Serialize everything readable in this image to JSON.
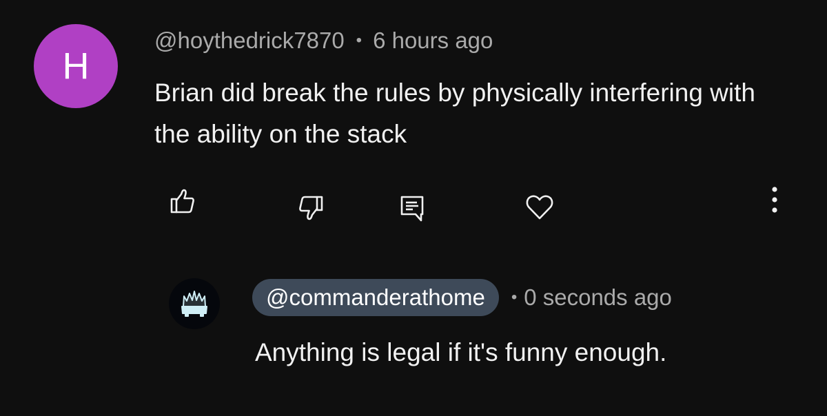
{
  "comment": {
    "avatar_letter": "H",
    "avatar_color": "#b040c4",
    "handle": "@hoythedrick7870",
    "separator": "•",
    "timestamp": "6 hours ago",
    "text": "Brian did break the rules by physically interfering with the ability on the stack",
    "actions": {
      "like_icon": "thumbs-up-icon",
      "dislike_icon": "thumbs-down-icon",
      "reply_icon": "reply-icon",
      "heart_icon": "heart-icon",
      "more_icon": "more-vertical-icon"
    }
  },
  "reply": {
    "avatar_icon": "crown-throne-icon",
    "avatar_accent": "#cfeef6",
    "handle": "@commanderathome",
    "separator": "•",
    "timestamp": "0 seconds ago",
    "text": "Anything is legal if it's funny enough."
  }
}
